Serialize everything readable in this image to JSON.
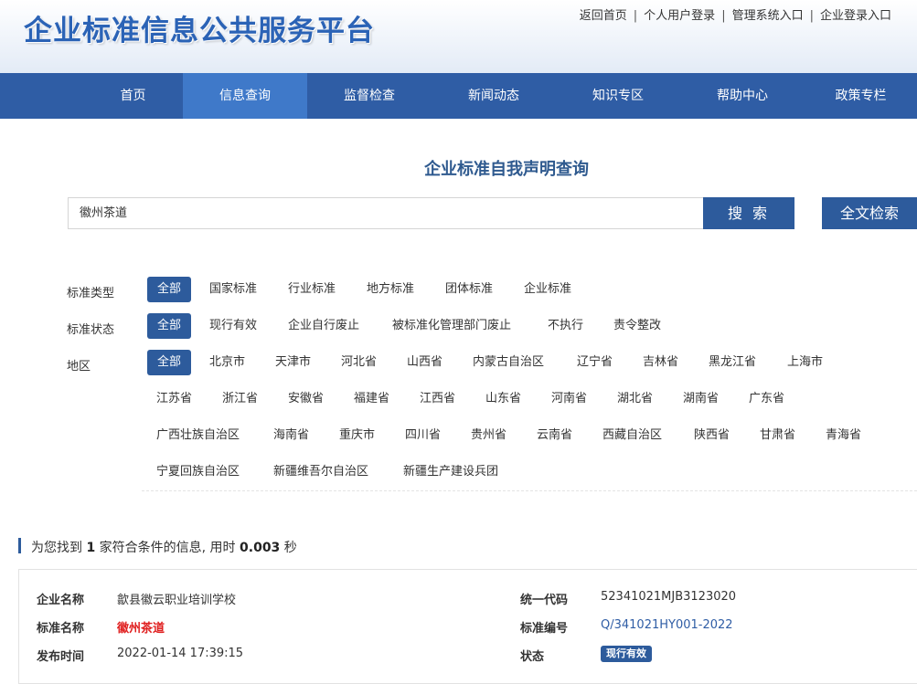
{
  "header": {
    "site_title": "企业标准信息公共服务平台",
    "links": [
      "返回首页",
      "个人用户登录",
      "管理系统入口",
      "企业登录入口"
    ]
  },
  "nav": {
    "items": [
      "首页",
      "信息查询",
      "监督检查",
      "新闻动态",
      "知识专区",
      "帮助中心",
      "政策专栏"
    ],
    "active": "信息查询"
  },
  "search": {
    "title": "企业标准自我声明查询",
    "query": "徽州茶道",
    "search_label": "搜 索",
    "fulltext_label": "全文检索"
  },
  "filters": {
    "type": {
      "label": "标准类型",
      "options": [
        "全部",
        "国家标准",
        "行业标准",
        "地方标准",
        "团体标准",
        "企业标准"
      ]
    },
    "status": {
      "label": "标准状态",
      "options": [
        "全部",
        "现行有效",
        "企业自行废止",
        "被标准化管理部门废止",
        "不执行",
        "责令整改"
      ]
    },
    "region": {
      "label": "地区",
      "options": [
        "全部",
        "北京市",
        "天津市",
        "河北省",
        "山西省",
        "内蒙古自治区",
        "辽宁省",
        "吉林省",
        "黑龙江省",
        "上海市",
        "江苏省",
        "浙江省",
        "安徽省",
        "福建省",
        "江西省",
        "山东省",
        "河南省",
        "湖北省",
        "湖南省",
        "广东省",
        "广西壮族自治区",
        "海南省",
        "重庆市",
        "四川省",
        "贵州省",
        "云南省",
        "西藏自治区",
        "陕西省",
        "甘肃省",
        "青海省",
        "宁夏回族自治区",
        "新疆维吾尔自治区",
        "新疆生产建设兵团"
      ]
    }
  },
  "result": {
    "prefix": "为您找到",
    "count": "1",
    "middle": "家符合条件的信息, 用时",
    "time": "0.003",
    "suffix": "秒"
  },
  "record": {
    "company_label": "企业名称",
    "company": "歙县徽云职业培训学校",
    "std_name_label": "标准名称",
    "std_name": "徽州茶道",
    "pub_time_label": "发布时间",
    "pub_time": "2022-01-14 17:39:15",
    "credit_code_label": "统一代码",
    "credit_code": "52341021MJB3123020",
    "std_no_label": "标准编号",
    "std_no": "Q/341021HY001-2022",
    "status_label": "状态",
    "status": "现行有效"
  },
  "colors": {
    "nav_bg": "#2f5da5",
    "nav_active": "#3f79c9",
    "button_bg": "#2d5b9c",
    "highlight_red": "#e02020"
  }
}
